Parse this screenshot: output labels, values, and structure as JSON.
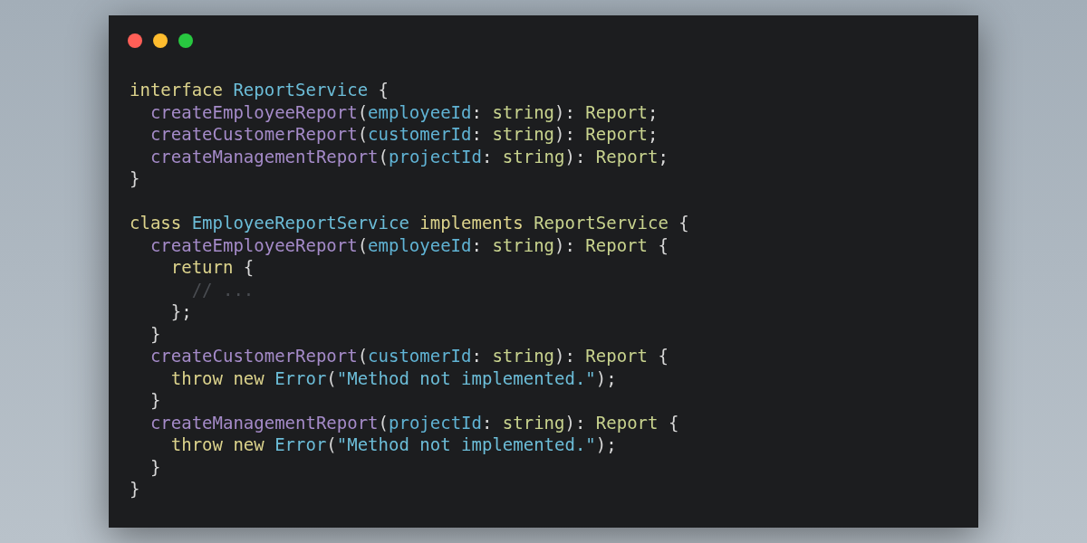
{
  "window": {
    "controls": [
      {
        "color": "#ff5f57"
      },
      {
        "color": "#febc2e"
      },
      {
        "color": "#28c840"
      }
    ]
  },
  "code_blocks": [
    {
      "lines": [
        {
          "tokens": [
            {
              "kind": "keyword",
              "text": "interface "
            },
            {
              "kind": "type",
              "text": "ReportService"
            },
            {
              "kind": "punct",
              "text": " {"
            }
          ],
          "children": [
            {
              "tokens": [
                {
                  "kind": "method",
                  "text": "createEmployeeReport"
                },
                {
                  "kind": "punct",
                  "text": "("
                },
                {
                  "kind": "param",
                  "text": "employeeId"
                },
                {
                  "kind": "punct",
                  "text": ": "
                },
                {
                  "kind": "primitive",
                  "text": "string"
                },
                {
                  "kind": "punct",
                  "text": "): "
                },
                {
                  "kind": "primitive",
                  "text": "Report"
                },
                {
                  "kind": "punct",
                  "text": ";"
                }
              ]
            },
            {
              "tokens": [
                {
                  "kind": "method",
                  "text": "createCustomerReport"
                },
                {
                  "kind": "punct",
                  "text": "("
                },
                {
                  "kind": "param",
                  "text": "customerId"
                },
                {
                  "kind": "punct",
                  "text": ": "
                },
                {
                  "kind": "primitive",
                  "text": "string"
                },
                {
                  "kind": "punct",
                  "text": "): "
                },
                {
                  "kind": "primitive",
                  "text": "Report"
                },
                {
                  "kind": "punct",
                  "text": ";"
                }
              ]
            },
            {
              "tokens": [
                {
                  "kind": "method",
                  "text": "createManagementReport"
                },
                {
                  "kind": "punct",
                  "text": "("
                },
                {
                  "kind": "param",
                  "text": "projectId"
                },
                {
                  "kind": "punct",
                  "text": ": "
                },
                {
                  "kind": "primitive",
                  "text": "string"
                },
                {
                  "kind": "punct",
                  "text": "): "
                },
                {
                  "kind": "primitive",
                  "text": "Report"
                },
                {
                  "kind": "punct",
                  "text": ";"
                }
              ]
            }
          ]
        },
        {
          "tokens": [
            {
              "kind": "punct",
              "text": "}"
            }
          ]
        }
      ]
    },
    {
      "lines": [
        {
          "tokens": [
            {
              "kind": "keyword",
              "text": "class "
            },
            {
              "kind": "type",
              "text": "EmployeeReportService"
            },
            {
              "kind": "keyword",
              "text": " implements "
            },
            {
              "kind": "primitive",
              "text": "ReportService"
            },
            {
              "kind": "punct",
              "text": " {"
            }
          ],
          "children": [
            {
              "tokens": [
                {
                  "kind": "method",
                  "text": "createEmployeeReport"
                },
                {
                  "kind": "punct",
                  "text": "("
                },
                {
                  "kind": "param",
                  "text": "employeeId"
                },
                {
                  "kind": "punct",
                  "text": ": "
                },
                {
                  "kind": "primitive",
                  "text": "string"
                },
                {
                  "kind": "punct",
                  "text": "): "
                },
                {
                  "kind": "primitive",
                  "text": "Report"
                },
                {
                  "kind": "punct",
                  "text": " {"
                }
              ],
              "children": [
                {
                  "tokens": [
                    {
                      "kind": "keyword",
                      "text": "return"
                    },
                    {
                      "kind": "punct",
                      "text": " {"
                    }
                  ],
                  "children": [
                    {
                      "tokens": [
                        {
                          "kind": "comment",
                          "text": "// ..."
                        }
                      ]
                    }
                  ]
                },
                {
                  "tokens": [
                    {
                      "kind": "punct",
                      "text": "};"
                    }
                  ]
                }
              ]
            },
            {
              "tokens": [
                {
                  "kind": "punct",
                  "text": "}"
                }
              ]
            },
            {
              "tokens": [
                {
                  "kind": "method",
                  "text": "createCustomerReport"
                },
                {
                  "kind": "punct",
                  "text": "("
                },
                {
                  "kind": "param",
                  "text": "customerId"
                },
                {
                  "kind": "punct",
                  "text": ": "
                },
                {
                  "kind": "primitive",
                  "text": "string"
                },
                {
                  "kind": "punct",
                  "text": "): "
                },
                {
                  "kind": "primitive",
                  "text": "Report"
                },
                {
                  "kind": "punct",
                  "text": " {"
                }
              ],
              "children": [
                {
                  "tokens": [
                    {
                      "kind": "keyword",
                      "text": "throw new "
                    },
                    {
                      "kind": "type",
                      "text": "Error"
                    },
                    {
                      "kind": "punct",
                      "text": "("
                    },
                    {
                      "kind": "string",
                      "text": "\"Method not implemented.\""
                    },
                    {
                      "kind": "punct",
                      "text": ");"
                    }
                  ]
                }
              ]
            },
            {
              "tokens": [
                {
                  "kind": "punct",
                  "text": "}"
                }
              ]
            },
            {
              "tokens": [
                {
                  "kind": "method",
                  "text": "createManagementReport"
                },
                {
                  "kind": "punct",
                  "text": "("
                },
                {
                  "kind": "param",
                  "text": "projectId"
                },
                {
                  "kind": "punct",
                  "text": ": "
                },
                {
                  "kind": "primitive",
                  "text": "string"
                },
                {
                  "kind": "punct",
                  "text": "): "
                },
                {
                  "kind": "primitive",
                  "text": "Report"
                },
                {
                  "kind": "punct",
                  "text": " {"
                }
              ],
              "children": [
                {
                  "tokens": [
                    {
                      "kind": "keyword",
                      "text": "throw new "
                    },
                    {
                      "kind": "type",
                      "text": "Error"
                    },
                    {
                      "kind": "punct",
                      "text": "("
                    },
                    {
                      "kind": "string",
                      "text": "\"Method not implemented.\""
                    },
                    {
                      "kind": "punct",
                      "text": ");"
                    }
                  ]
                }
              ]
            },
            {
              "tokens": [
                {
                  "kind": "punct",
                  "text": "}"
                }
              ]
            }
          ]
        },
        {
          "tokens": [
            {
              "kind": "punct",
              "text": "}"
            }
          ]
        }
      ]
    }
  ]
}
